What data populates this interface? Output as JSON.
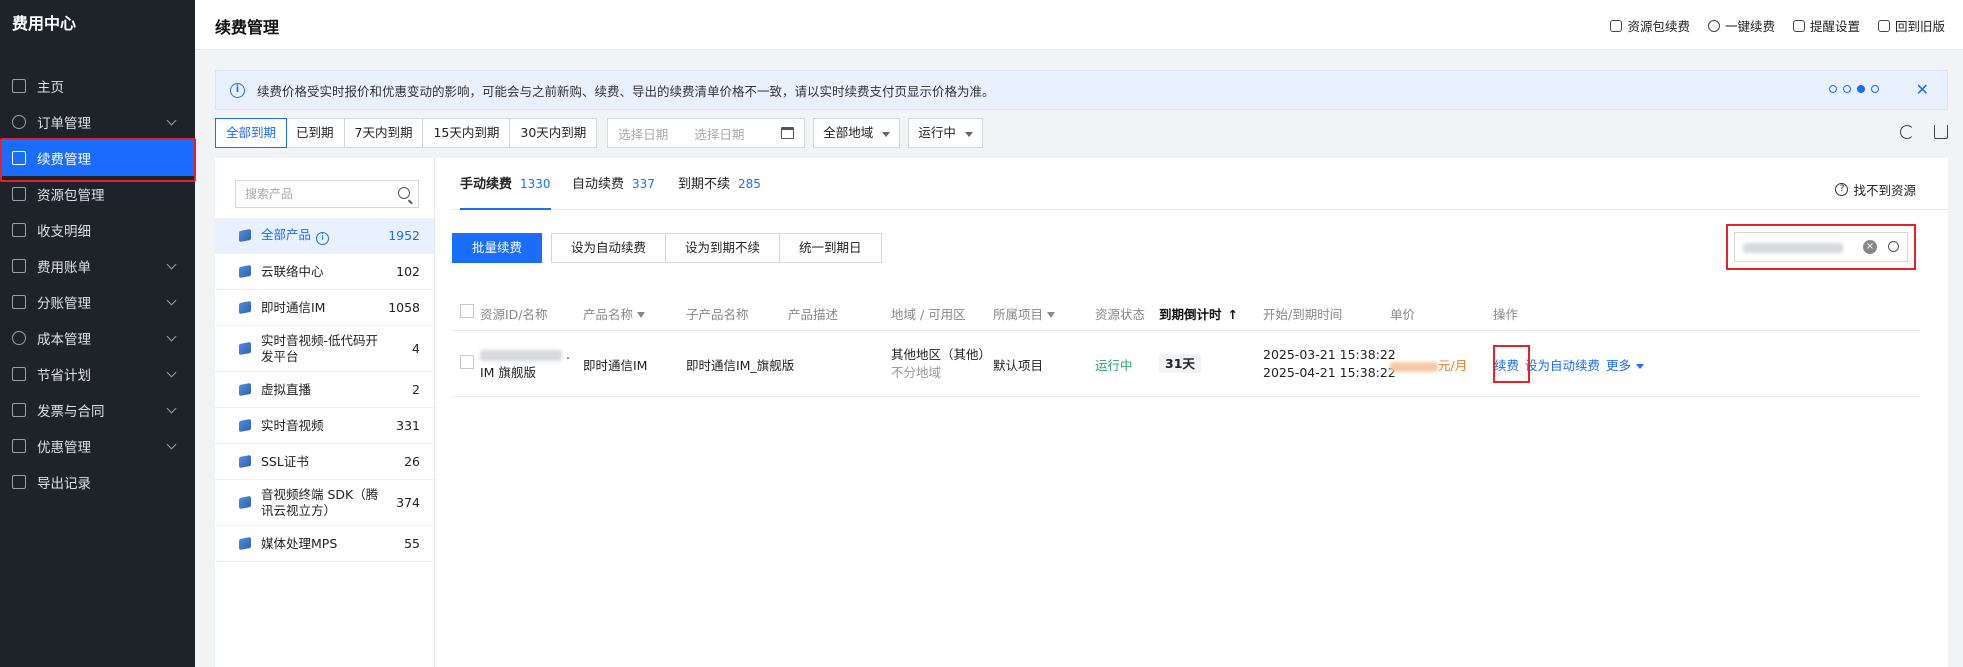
{
  "sidebar": {
    "brand": "费用中心",
    "items": [
      {
        "label": "主页"
      },
      {
        "label": "订单管理"
      },
      {
        "label": "续费管理"
      },
      {
        "label": "资源包管理"
      },
      {
        "label": "收支明细"
      },
      {
        "label": "费用账单"
      },
      {
        "label": "分账管理"
      },
      {
        "label": "成本管理"
      },
      {
        "label": "节省计划"
      },
      {
        "label": "发票与合同"
      },
      {
        "label": "优惠管理"
      },
      {
        "label": "导出记录"
      }
    ]
  },
  "header": {
    "title": "续费管理",
    "actions": [
      "资源包续费",
      "一键续费",
      "提醒设置",
      "回到旧版"
    ]
  },
  "notice": {
    "text": "续费价格受实时报价和优惠变动的影响，可能会与之前新购、续费、导出的续费清单价格不一致，请以实时续费支付页显示价格为准。",
    "close": "✕"
  },
  "filters": {
    "period_buttons": [
      "全部到期",
      "已到期",
      "7天内到期",
      "15天内到期",
      "30天内到期"
    ],
    "date_start_placeholder": "选择日期",
    "date_end_placeholder": "选择日期",
    "region": "全部地域",
    "status": "运行中"
  },
  "products": {
    "search_placeholder": "搜索产品",
    "items": [
      {
        "name": "全部产品",
        "count": "1952"
      },
      {
        "name": "云联络中心",
        "count": "102"
      },
      {
        "name": "即时通信IM",
        "count": "1058"
      },
      {
        "name": "实时音视频-低代码开发平台",
        "count": "4"
      },
      {
        "name": "虚拟直播",
        "count": "2"
      },
      {
        "name": "实时音视频",
        "count": "331"
      },
      {
        "name": "SSL证书",
        "count": "26"
      },
      {
        "name": "音视频终端 SDK（腾讯云视立方）",
        "count": "374"
      },
      {
        "name": "媒体处理MPS",
        "count": "55"
      }
    ]
  },
  "tabs": [
    {
      "label": "手动续费",
      "count": "1330"
    },
    {
      "label": "自动续费",
      "count": "337"
    },
    {
      "label": "到期不续",
      "count": "285"
    }
  ],
  "not_found": "找不到资源",
  "bulk_actions": [
    "批量续费",
    "设为自动续费",
    "设为到期不续",
    "统一到期日"
  ],
  "table": {
    "headers": [
      "资源ID/名称",
      "产品名称",
      "子产品名称",
      "产品描述",
      "地域 / 可用区",
      "所属项目",
      "资源状态",
      "到期倒计时",
      "开始/到期时间",
      "单价",
      "操作"
    ],
    "rows": [
      {
        "name_suffix": "IM 旗舰版",
        "product": "即时通信IM",
        "sub_product": "即时通信IM_旗舰版",
        "desc": "-",
        "region": "其他地区（其他）",
        "zone": "不分地域",
        "project": "默认项目",
        "status": "运行中",
        "countdown": "31天",
        "start_time": "2025-03-21 15:38:22",
        "end_time": "2025-04-21 15:38:22",
        "price_unit": "元/月",
        "op_renew": "续费",
        "op_auto": "设为自动续费",
        "op_more": "更多"
      }
    ]
  },
  "colors": {
    "accent": "#1a6dff",
    "sidebar_bg": "#1e2229",
    "highlight_border": "#e6212a",
    "running": "#2ba471",
    "price": "#f47c2d"
  }
}
